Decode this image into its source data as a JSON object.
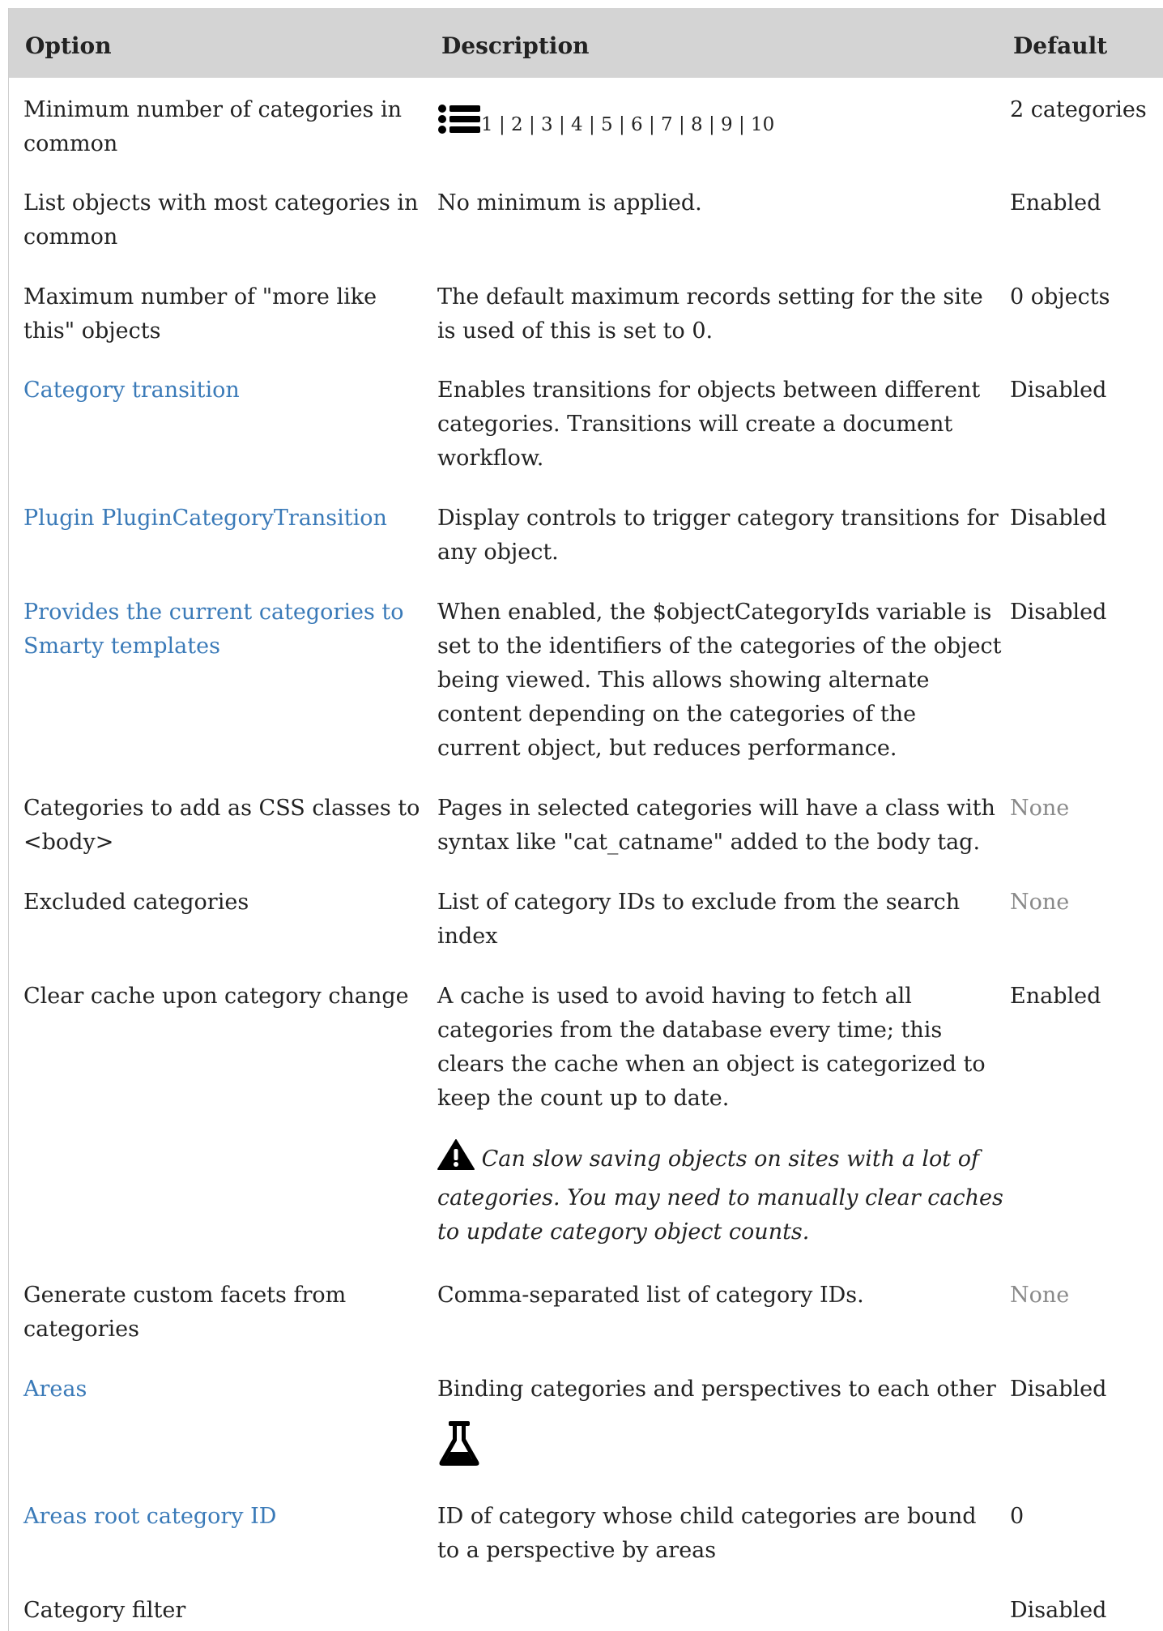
{
  "table": {
    "headers": {
      "option": "Option",
      "description": "Description",
      "default": "Default"
    },
    "rows": [
      {
        "option": "Minimum number of categories in common",
        "pager": "1 | 2 | 3 | 4 | 5 | 6 | 7 | 8 | 9 | 10",
        "default": "2 categories"
      },
      {
        "option": "List objects with most categories in common",
        "description": "No minimum is applied.",
        "default": "Enabled"
      },
      {
        "option": "Maximum number of \"more like this\" objects",
        "description": "The default maximum records setting for the site is used of this is set to 0.",
        "default": "0 objects"
      },
      {
        "option": "Category transition",
        "description": "Enables transitions for objects between different categories. Transitions will create a document workflow.",
        "default": "Disabled"
      },
      {
        "option": "Plugin PluginCategoryTransition",
        "description": "Display controls to trigger category transitions for any object.",
        "default": "Disabled"
      },
      {
        "option": "Provides the current categories to Smarty templates",
        "description": "When enabled, the $objectCategoryIds variable is set to the identifiers of the categories of the object being viewed. This allows showing alternate content depending on the categories of the current object, but reduces performance.",
        "default": "Disabled"
      },
      {
        "option": "Categories to add as CSS classes to <body>",
        "description": "Pages in selected categories will have a class with syntax like \"cat_catname\" added to the body tag.",
        "default": "None"
      },
      {
        "option": "Excluded categories",
        "description": "List of category IDs to exclude from the search index",
        "default": "None"
      },
      {
        "option": "Clear cache upon category change",
        "description": "A cache is used to avoid having to fetch all categories from the database every time; this clears the cache when an object is categorized to keep the count up to date.",
        "warning": "Can slow saving objects on sites with a lot of categories. You may need to manually clear caches to update category object counts.",
        "default": "Enabled"
      },
      {
        "option": "Generate custom facets from categories",
        "description": "Comma-separated list of category IDs.",
        "default": "None"
      },
      {
        "option": "Areas",
        "description": "Binding categories and perspectives to each other",
        "default": "Disabled"
      },
      {
        "option": "Areas root category ID",
        "description": "ID of category whose child categories are bound to a perspective by areas",
        "default": "0"
      },
      {
        "option": "Category filter",
        "default": "Disabled"
      }
    ]
  },
  "icons": {
    "list": "list-icon",
    "warning": "warning-icon",
    "experimental": "flask-icon"
  },
  "colors": {
    "header_bg": "#d4d4d4",
    "link": "#3a7ab8",
    "muted": "#8a8a8a",
    "text": "#222222"
  }
}
